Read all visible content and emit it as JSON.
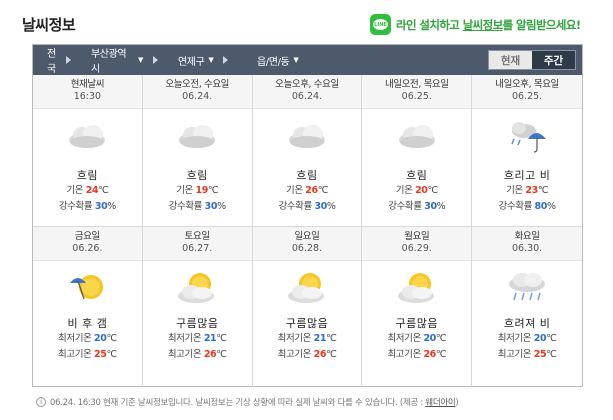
{
  "header": {
    "title": "날씨정보",
    "line_icon_text": "LINE",
    "promo_pre": "라인 설치하고 ",
    "promo_link": "날씨정보",
    "promo_post": "를 알림받으세요!"
  },
  "nav": {
    "crumbs": [
      "전국",
      "부산광역시",
      "연제구",
      "읍/면/동"
    ],
    "toggle": {
      "current": "현재",
      "weekly": "주간"
    }
  },
  "colors": {
    "nav_bg": "#4d5a6b",
    "hot": "#e8371d",
    "cold": "#2f6cc7",
    "line_green": "#2fbf3c"
  },
  "today": [
    {
      "day": "현재날씨",
      "date": "16:30",
      "icon": "cloudy-icon",
      "cond": "흐림",
      "temp_label": "기온",
      "temp": "24",
      "unit": "℃",
      "rain_label": "강수확률",
      "rain": "30",
      "pct": "%"
    },
    {
      "day": "오늘오전, 수요일",
      "date": "06.24.",
      "icon": "cloudy-icon",
      "cond": "흐림",
      "temp_label": "기온",
      "temp": "19",
      "unit": "℃",
      "rain_label": "강수확률",
      "rain": "30",
      "pct": "%"
    },
    {
      "day": "오늘오후, 수요일",
      "date": "06.24.",
      "icon": "cloudy-icon",
      "cond": "흐림",
      "temp_label": "기온",
      "temp": "26",
      "unit": "℃",
      "rain_label": "강수확률",
      "rain": "30",
      "pct": "%"
    },
    {
      "day": "내일오전, 목요일",
      "date": "06.25.",
      "icon": "cloudy-icon",
      "cond": "흐림",
      "temp_label": "기온",
      "temp": "20",
      "unit": "℃",
      "rain_label": "강수확률",
      "rain": "30",
      "pct": "%"
    },
    {
      "day": "내일오후, 목요일",
      "date": "06.25.",
      "icon": "cloudy-rain-umbrella-icon",
      "cond": "흐리고 비",
      "temp_label": "기온",
      "temp": "23",
      "unit": "℃",
      "rain_label": "강수확률",
      "rain": "80",
      "pct": "%"
    }
  ],
  "weekly": [
    {
      "day": "금요일",
      "date": "06.26.",
      "icon": "rain-then-sun-icon",
      "cond": "비 후 갬",
      "min_label": "최저기온",
      "min": "20",
      "max_label": "최고기온",
      "max": "25",
      "unit": "℃"
    },
    {
      "day": "토요일",
      "date": "06.27.",
      "icon": "partly-cloudy-icon",
      "cond": "구름많음",
      "min_label": "최저기온",
      "min": "21",
      "max_label": "최고기온",
      "max": "26",
      "unit": "℃"
    },
    {
      "day": "일요일",
      "date": "06.28.",
      "icon": "partly-cloudy-icon",
      "cond": "구름많음",
      "min_label": "최저기온",
      "min": "21",
      "max_label": "최고기온",
      "max": "26",
      "unit": "℃"
    },
    {
      "day": "월요일",
      "date": "06.29.",
      "icon": "partly-cloudy-icon",
      "cond": "구름많음",
      "min_label": "최저기온",
      "min": "20",
      "max_label": "최고기온",
      "max": "26",
      "unit": "℃"
    },
    {
      "day": "화요일",
      "date": "06.30.",
      "icon": "cloudy-rain-icon",
      "cond": "흐려져 비",
      "min_label": "최저기온",
      "min": "20",
      "max_label": "최고기온",
      "max": "25",
      "unit": "℃"
    }
  ],
  "footer": {
    "note": "06.24. 16:30 현재 기준 날씨정보입니다. 날씨정보는 기상 상황에 따라 실제 날씨와 다를 수 있습니다. (제공 : ",
    "provider": "웨더아이",
    "close": ")"
  }
}
